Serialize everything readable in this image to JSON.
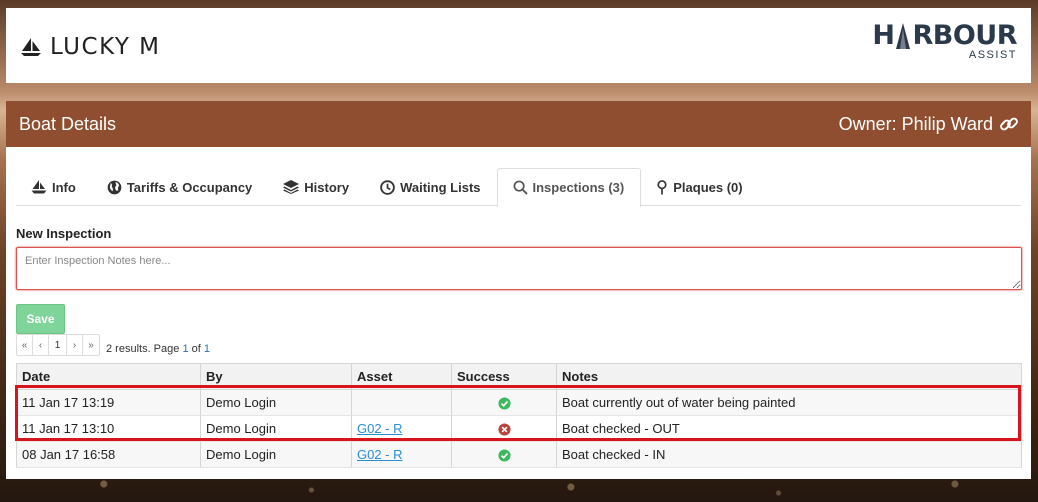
{
  "header": {
    "boat_name": "LUCKY M",
    "logo_main_left": "H",
    "logo_main_right": "RBOUR",
    "logo_sub": "ASSIST"
  },
  "panel": {
    "title": "Boat Details",
    "owner": "Owner: Philip Ward"
  },
  "tabs": [
    {
      "label": "Info",
      "icon": "boat-icon"
    },
    {
      "label": "Tariffs & Occupancy",
      "icon": "globe-icon"
    },
    {
      "label": "History",
      "icon": "layers-icon"
    },
    {
      "label": "Waiting Lists",
      "icon": "clock-icon"
    },
    {
      "label": "Inspections (3)",
      "icon": "search-icon",
      "active": true
    },
    {
      "label": "Plaques (0)",
      "icon": "pin-icon"
    }
  ],
  "new_inspection": {
    "label": "New Inspection",
    "placeholder": "Enter Inspection Notes here...",
    "save_label": "Save"
  },
  "pager": {
    "first": "«",
    "prev": "‹",
    "page": "1",
    "next": "›",
    "last": "»",
    "results_prefix": "2 results. Page ",
    "page_current": "1",
    "results_of": " of ",
    "page_total": "1"
  },
  "table": {
    "columns": [
      "Date",
      "By",
      "Asset",
      "Success",
      "Notes"
    ],
    "rows": [
      {
        "date": "11 Jan 17 13:19",
        "by": "Demo Login",
        "asset": "",
        "success": true,
        "notes": "Boat currently out of water being painted"
      },
      {
        "date": "11 Jan 17 13:10",
        "by": "Demo Login",
        "asset": "G02 - R",
        "success": false,
        "notes": "Boat checked - OUT"
      },
      {
        "date": "08 Jan 17 16:58",
        "by": "Demo Login",
        "asset": "G02 - R",
        "success": true,
        "notes": "Boat checked - IN"
      }
    ]
  },
  "colors": {
    "header_brown": "#8e4e2f",
    "success_green": "#3cb95d",
    "fail_red": "#b8433a",
    "highlight_red": "#d8141c",
    "save_green": "#7fd49a",
    "link_blue": "#2a8fcf"
  }
}
